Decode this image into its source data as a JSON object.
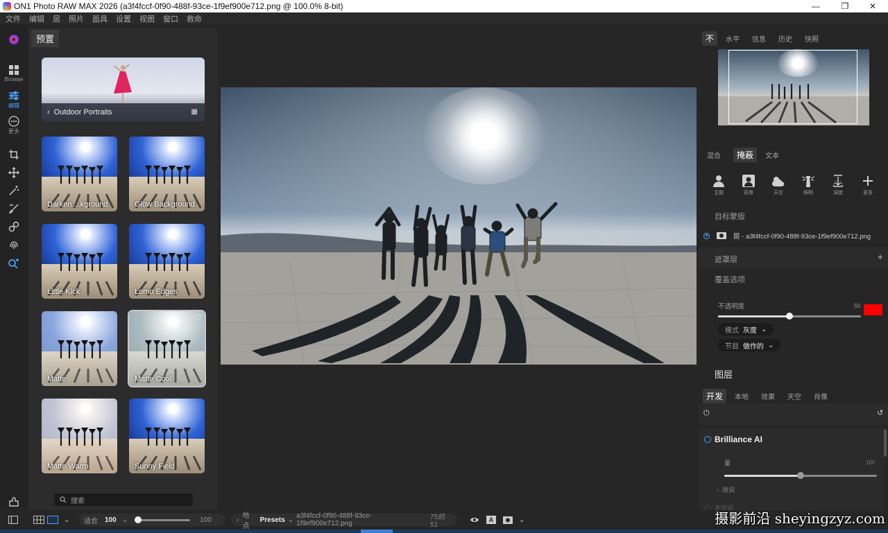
{
  "window": {
    "title": "ON1 Photo RAW MAX 2026 (a3f4fccf-0f90-488f-93ce-1f9ef900e712.png @ 100.0% 8-bit)",
    "minimize": "—",
    "maximize": "❐",
    "close": "✕"
  },
  "menu": [
    "文件",
    "编辑",
    "层",
    "照片",
    "面具",
    "设置",
    "视图",
    "窗口",
    "救命"
  ],
  "toolstrip": {
    "browse_label": "Browse",
    "edit_label": "编辑",
    "more_label": "更多"
  },
  "presets": {
    "panel_title": "预置",
    "category": "Outdoor Portraits",
    "items": [
      {
        "label": "Darken ...kground"
      },
      {
        "label": "Glow Background"
      },
      {
        "label": "Little Kick"
      },
      {
        "label": "Lomo Edges"
      },
      {
        "label": "Matte"
      },
      {
        "label": "Matte Cool"
      },
      {
        "label": "Matte Warm"
      },
      {
        "label": "Sunny Field"
      }
    ],
    "search_placeholder": "搜索"
  },
  "right": {
    "top_tabs": [
      "不",
      "水平",
      "信息",
      "历史",
      "快照"
    ],
    "mask_tabs": [
      "混合",
      "掩蔽",
      "文本"
    ],
    "mask_tools": [
      {
        "label": "主题",
        "icon": "person-icon"
      },
      {
        "label": "背景",
        "icon": "portrait-icon"
      },
      {
        "label": "天空",
        "icon": "cloud-icon"
      },
      {
        "label": "照明",
        "icon": "lighthouse-icon"
      },
      {
        "label": "深度",
        "icon": "depth-icon"
      },
      {
        "label": "更多",
        "icon": "plus-icon"
      }
    ],
    "target_mask_title": "目标蒙版",
    "layer_name": "层 - a3f4fccf-0f90-488f-93ce-1f9ef900e712.png",
    "mask_layer_title": "遮罩层",
    "overlay_title": "覆盖选项",
    "opacity_label": "不透明度",
    "opacity_value": "50",
    "opacity": 50,
    "overlay_color": "#ff0000",
    "mode_label": "模式",
    "mode_value": "灰度",
    "section_label": "节目",
    "section_value": "做作的",
    "layers_title": "图层",
    "dev_tabs": [
      "开发",
      "本地",
      "效果",
      "天空",
      "肖像"
    ],
    "brilliance_title": "Brilliance AI",
    "amount_label": "量",
    "amount_value": "100",
    "amount": 100,
    "fine_tune_label": "微调",
    "partial_label": "本地调"
  },
  "bottom": {
    "fit_label": "适合",
    "zoom_value": "100",
    "slider_value": "100",
    "location_label": "地点",
    "presets_label": "Presets",
    "filename": "a3f4fccf-0f90-488f-93ce-1f9ef900e712.png",
    "counter": "75的51"
  },
  "watermark": "摄影前沿 sheyingzyz.com",
  "colors": {
    "accent": "#4aa3ff",
    "overlay": "#ff0000"
  }
}
